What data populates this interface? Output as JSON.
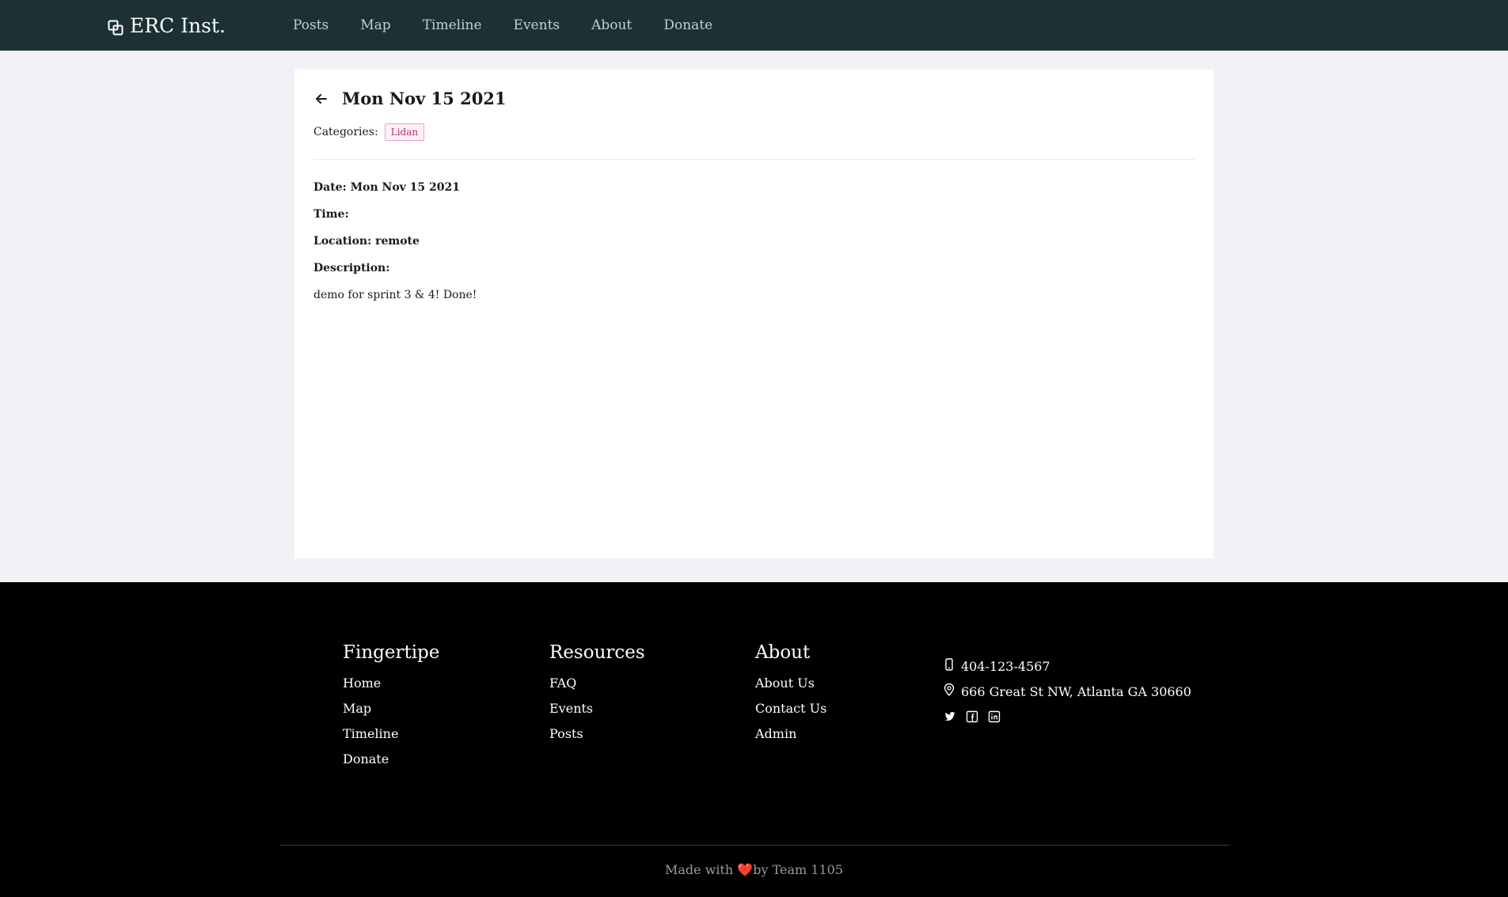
{
  "brand": {
    "name": "ERC Inst.",
    "icon": "copy-squares-icon"
  },
  "nav": {
    "items": [
      "Posts",
      "Map",
      "Timeline",
      "Events",
      "About",
      "Donate"
    ]
  },
  "event": {
    "title": "Mon Nov 15 2021",
    "categories_label": "Categories:",
    "category": "Lidan",
    "date_line": "Date: Mon Nov 15 2021",
    "time_line": "Time:",
    "location_line": "Location: remote",
    "description_label": "Description:",
    "description": "demo for sprint 3 & 4! Done!"
  },
  "footer": {
    "col1": {
      "title": "Fingertipe",
      "links": [
        "Home",
        "Map",
        "Timeline",
        "Donate"
      ]
    },
    "col2": {
      "title": "Resources",
      "links": [
        "FAQ",
        "Events",
        "Posts"
      ]
    },
    "col3": {
      "title": "About",
      "links": [
        "About Us",
        "Contact Us",
        "Admin"
      ]
    },
    "contact": {
      "phone": "404-123-4567",
      "address": "666 Great St NW, Atlanta GA 30660"
    },
    "socials": [
      "twitter-icon",
      "facebook-icon",
      "linkedin-icon"
    ],
    "made_with_prefix": "Made with ",
    "heart": "❤️",
    "made_with_suffix": "by Team 1105"
  },
  "colors": {
    "topbar": "#1c3133",
    "page_bg": "#f0f2f5",
    "footer_bg": "#000000",
    "tag_border": "#e7a3c4",
    "tag_text": "#c0296f"
  }
}
